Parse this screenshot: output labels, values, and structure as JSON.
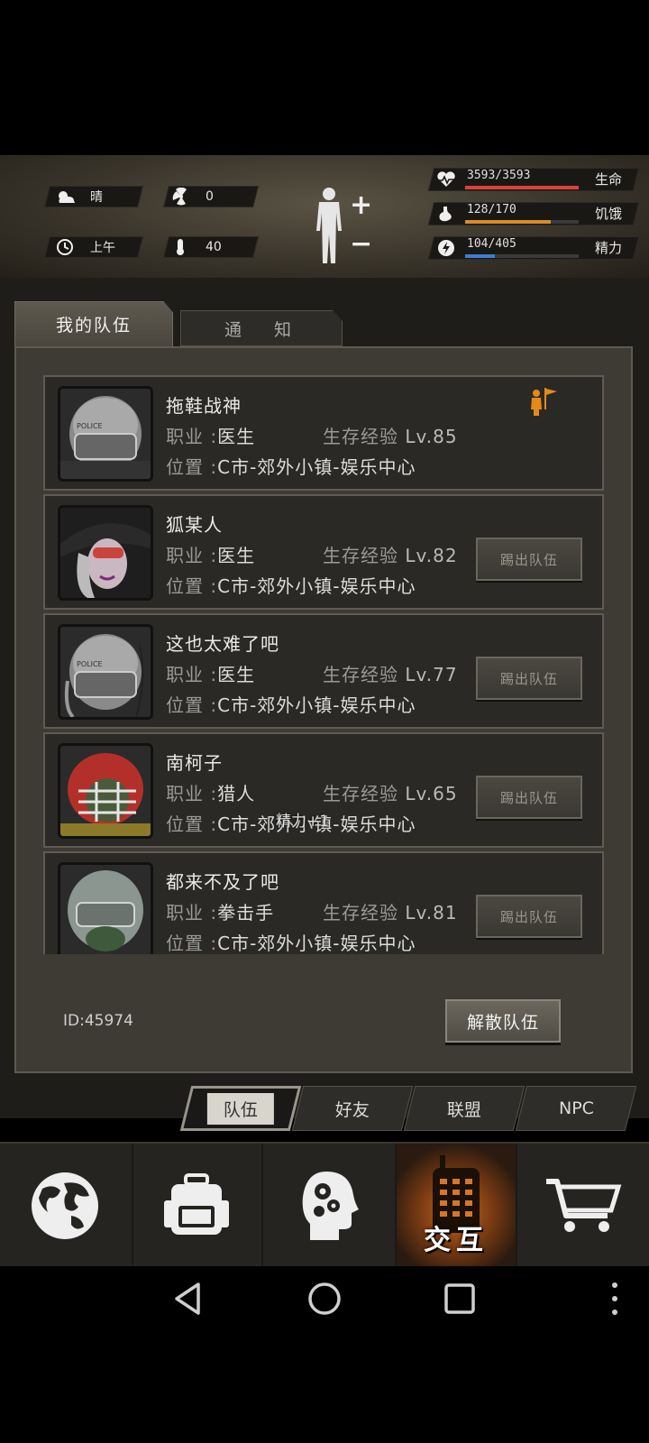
{
  "status": {
    "weather": "晴",
    "radiation": "0",
    "time_of_day": "上午",
    "temperature": "40",
    "health": {
      "value": "3593/3593",
      "label": "生命",
      "fraction": 1.0,
      "color": "#d9433b"
    },
    "hunger": {
      "value": "128/170",
      "label": "饥饿",
      "fraction": 0.75,
      "color": "#d98c26"
    },
    "energy": {
      "value": "104/405",
      "label": "精力",
      "fraction": 0.26,
      "color": "#3b7fd1"
    }
  },
  "tabs": {
    "my_team": "我的队伍",
    "notice": "通  知"
  },
  "members": [
    {
      "name": "拖鞋战神",
      "job_label": "职业 :",
      "job": "医生",
      "exp_label": "生存经验",
      "level": "Lv.85",
      "loc_label": "位置 :",
      "location": "C市-郊外小镇-娱乐中心",
      "leader": true
    },
    {
      "name": "狐某人",
      "job_label": "职业 :",
      "job": "医生",
      "exp_label": "生存经验",
      "level": "Lv.82",
      "loc_label": "位置 :",
      "location": "C市-郊外小镇-娱乐中心",
      "kick": "踢出队伍"
    },
    {
      "name": "这也太难了吧",
      "job_label": "职业 :",
      "job": "医生",
      "exp_label": "生存经验",
      "level": "Lv.77",
      "loc_label": "位置 :",
      "location": "C市-郊外小镇-娱乐中心",
      "kick": "踢出队伍"
    },
    {
      "name": "南柯子",
      "job_label": "职业 :",
      "job": "猎人",
      "exp_label": "生存经验",
      "level": "Lv.65",
      "loc_label": "位置 :",
      "location": "C市-郊外小镇-娱乐中心",
      "kick": "踢出队伍"
    },
    {
      "name": "都来不及了吧",
      "job_label": "职业 :",
      "job": "拳击手",
      "exp_label": "生存经验",
      "level": "Lv.81",
      "loc_label": "位置 :",
      "location": "C市-郊外小镇-娱乐中心",
      "kick": "踢出队伍"
    }
  ],
  "floating_text": "精力+1",
  "team_id": "ID:45974",
  "disband_label": "解散队伍",
  "subtabs": [
    "队伍",
    "好友",
    "联盟",
    "NPC"
  ],
  "nav": {
    "interact_label": "交互"
  },
  "icons": [
    "sun-cloud-icon",
    "radiation-icon",
    "clock-icon",
    "thermometer-icon",
    "heart-icon",
    "stomach-icon",
    "energy-icon",
    "body-icon",
    "leader-flag-icon",
    "globe-icon",
    "backpack-icon",
    "head-gear-icon",
    "radio-icon",
    "cart-icon",
    "back-icon",
    "home-icon",
    "recents-icon",
    "more-icon"
  ]
}
